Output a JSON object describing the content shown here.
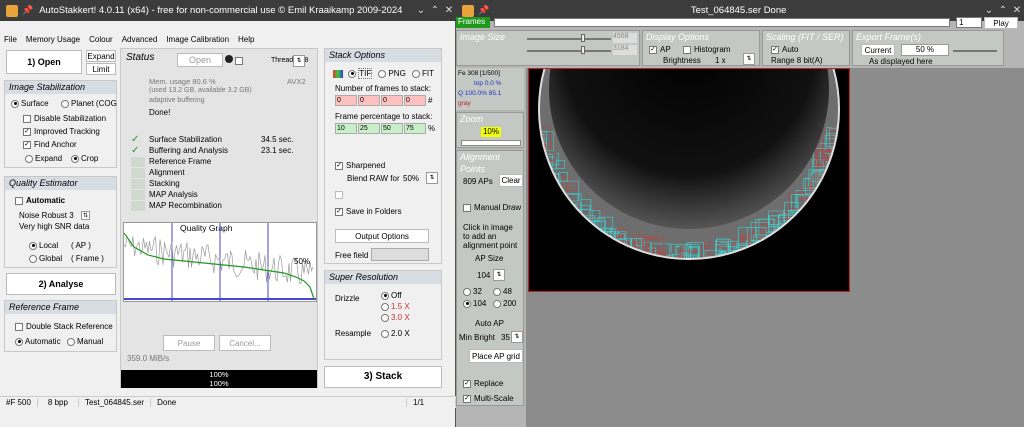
{
  "app": {
    "title": "AutoStakkert! 4.0.11 (x64) - free for non-commercial use © Emil Kraaikamp 2009-2024",
    "menu": [
      "File",
      "Memory Usage",
      "Colour",
      "Advanced",
      "Image Calibration",
      "Help"
    ],
    "open": "1) Open",
    "expand": "Expand",
    "limit": "Limit",
    "img_stab": {
      "header": "Image Stabilization",
      "surface": "Surface",
      "planet": "Planet (COG",
      "disable": "Disable Stabilization",
      "improved": "Improved Tracking",
      "find": "Find Anchor",
      "expand": "Expand",
      "crop": "Crop"
    },
    "quality": {
      "header": "Quality Estimator",
      "automatic": "Automatic",
      "noise": "Noise Robust 3",
      "snr": "Very high SNR data",
      "local": "Local",
      "local_ap": "( AP )",
      "global": "Global",
      "global_frame": "( Frame )"
    },
    "analyse": "2) Analyse",
    "ref": {
      "header": "Reference Frame",
      "double": "Double Stack Reference",
      "automatic": "Automatic",
      "manual": "Manual"
    },
    "status": {
      "header": "Status",
      "open": "Open",
      "threads": "Threads 8/8",
      "mem": "Mem. usage 80.6 %",
      "used": "(used 13.2 GB, available 3.2 GB)",
      "adaptive": "adaptive buffering",
      "avx": "AVX2",
      "done": "Done!",
      "steps": [
        {
          "label": "Surface Stabilization",
          "time": "34.5 sec."
        },
        {
          "label": "Buffering and Analysis",
          "time": "23.1 sec."
        },
        {
          "label": "Reference Frame",
          "time": ""
        },
        {
          "label": "Alignment",
          "time": ""
        },
        {
          "label": "Stacking",
          "time": ""
        },
        {
          "label": "MAP Analysis",
          "time": ""
        },
        {
          "label": "MAP Recombination",
          "time": ""
        }
      ],
      "graph_title": "Quality Graph",
      "graph_pct": "50%",
      "pause": "Pause",
      "cancel": "Cancel...",
      "speed": "359.0 MiB/s",
      "prog1": "100%",
      "prog2": "100%"
    },
    "stack": {
      "header": "Stack Options",
      "tif": "TIF",
      "png": "PNG",
      "fit": "FIT",
      "nframes_label": "Number of frames to stack:",
      "nframes": [
        "0",
        "0",
        "0",
        "0"
      ],
      "pct_label": "Frame percentage to stack:",
      "pct": [
        "10",
        "25",
        "50",
        "75"
      ],
      "hash": "#",
      "pct_sign": "%",
      "sharpened": "Sharpened",
      "blend": "Blend RAW for",
      "blend_val": "50%",
      "save": "Save in Folders",
      "output": "Output Options",
      "free": "Free field"
    },
    "super": {
      "header": "Super Resolution",
      "drizzle": "Drizzle",
      "off": "Off",
      "x15": "1.5 X",
      "x30": "3.0 X",
      "resample": "Resample",
      "x20": "2.0 X"
    },
    "stack_btn": "3) Stack",
    "statusbar": [
      "#F 500",
      "8 bpp",
      "Test_064845.ser",
      "Done",
      "1/1"
    ]
  },
  "viewer": {
    "title": "Test_064845.ser Done",
    "frames": "Frames",
    "frame_num": "1",
    "play": "Play",
    "imgsize": {
      "header": "Image Size",
      "w": "4568",
      "h": "3184"
    },
    "display": {
      "header": "Display Options",
      "ap": "AP",
      "histogram": "Histogram",
      "brightness": "Brightness",
      "bright_val": "1 x"
    },
    "scaling": {
      "header": "Scaling (FIT / SER)",
      "auto": "Auto",
      "range": "Range 8 bit(A)"
    },
    "export": {
      "header": "Export Frame(s)",
      "current": "Current",
      "pct": "50 %",
      "as_displayed": "As displayed here"
    },
    "info": {
      "line1": "Fe 308 [1/500]",
      "line2": "top 0.0 %",
      "line3": "Q 100.0%  85.1",
      "line4": "gray"
    },
    "zoom": {
      "header": "Zoom",
      "value": "10%"
    },
    "align": {
      "header": "Alignment Points",
      "aps": "809 APs",
      "clear": "Clear",
      "manual": "Manual Draw",
      "hint1": "Click in image",
      "hint2": "to add an",
      "hint3": "alignment point",
      "apsize": "AP Size",
      "size_val": "104",
      "s32": "32",
      "s48": "48",
      "s104": "104",
      "s200": "200",
      "autoap": "Auto AP",
      "minbright": "Min Bright",
      "minbright_val": "35",
      "place": "Place AP grid",
      "replace": "Replace",
      "multiscale": "Multi-Scale"
    }
  },
  "colors": {
    "accent_green": "#1f9a1f",
    "highlight_yellow": "#f2ff00",
    "pink_field": "#ffc0c0",
    "green_field": "#c8f0c8"
  }
}
